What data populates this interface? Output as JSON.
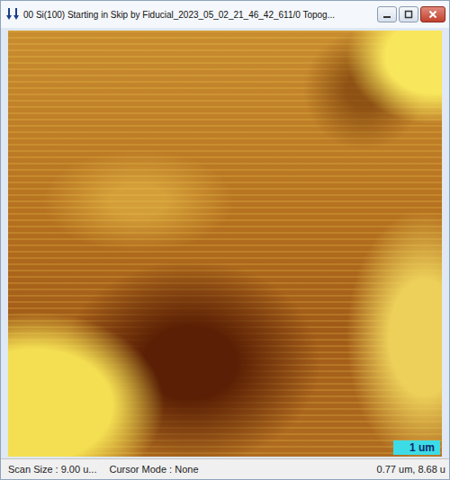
{
  "window": {
    "title": "00 Si(100) Starting in Skip by Fiducial_2023_05_02_21_46_42_611/0 Topog..."
  },
  "image": {
    "scale_bar": "1 um"
  },
  "status_bar": [
    "Scan Size : 9.00 u...",
    "Cursor Mode : None",
    "0.77 um, 8.68 u"
  ]
}
